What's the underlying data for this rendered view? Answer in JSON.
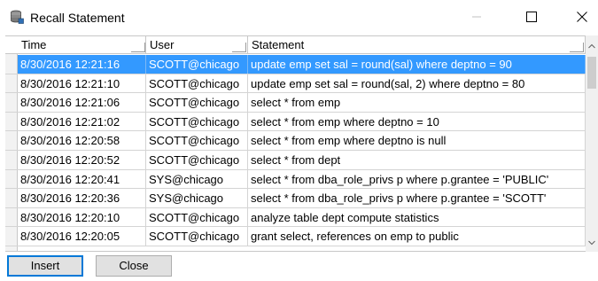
{
  "window": {
    "title": "Recall Statement"
  },
  "columns": [
    "Time",
    "User",
    "Statement"
  ],
  "rows": [
    {
      "time": "8/30/2016 12:21:16",
      "user": "SCOTT@chicago",
      "statement": "update emp set sal = round(sal) where deptno = 90",
      "selected": true
    },
    {
      "time": "8/30/2016 12:21:10",
      "user": "SCOTT@chicago",
      "statement": "update emp set sal = round(sal, 2) where deptno = 80"
    },
    {
      "time": "8/30/2016 12:21:06",
      "user": "SCOTT@chicago",
      "statement": "select * from emp"
    },
    {
      "time": "8/30/2016 12:21:02",
      "user": "SCOTT@chicago",
      "statement": "select * from emp where deptno = 10"
    },
    {
      "time": "8/30/2016 12:20:58",
      "user": "SCOTT@chicago",
      "statement": "select * from emp where deptno is null"
    },
    {
      "time": "8/30/2016 12:20:52",
      "user": "SCOTT@chicago",
      "statement": "select * from dept"
    },
    {
      "time": "8/30/2016 12:20:41",
      "user": "SYS@chicago",
      "statement": "select * from dba_role_privs p where p.grantee = 'PUBLIC'"
    },
    {
      "time": "8/30/2016 12:20:36",
      "user": "SYS@chicago",
      "statement": "select * from dba_role_privs p where p.grantee = 'SCOTT'"
    },
    {
      "time": "8/30/2016 12:20:10",
      "user": "SCOTT@chicago",
      "statement": "analyze table dept compute statistics"
    },
    {
      "time": "8/30/2016 12:20:05",
      "user": "SCOTT@chicago",
      "statement": "grant select, references on emp to public"
    }
  ],
  "buttons": {
    "insert": "Insert",
    "close": "Close"
  },
  "colors": {
    "selection": "#3399ff",
    "focus_border": "#0078d7"
  },
  "icons": {
    "app": "database-stack-icon",
    "minimize": "minimize-icon",
    "maximize": "maximize-icon",
    "close": "close-icon"
  }
}
